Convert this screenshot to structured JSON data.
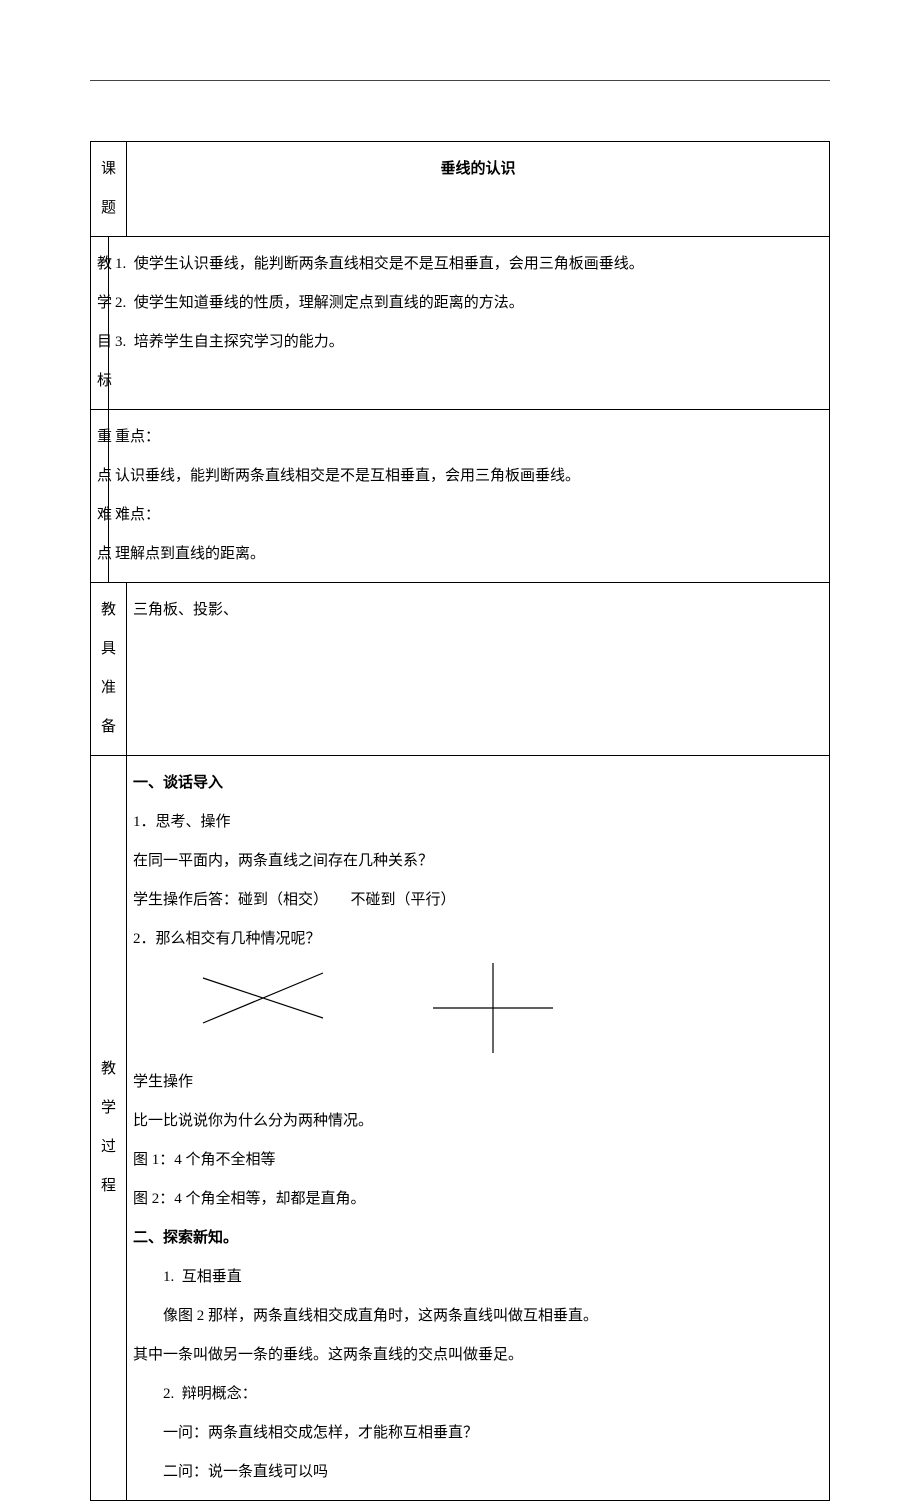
{
  "header": {
    "col_title_label": "课题",
    "title": "垂线的认识"
  },
  "objectives": {
    "label_chars": [
      "教",
      "学",
      "目",
      "标"
    ],
    "items": [
      {
        "num": "1.",
        "text": "使学生认识垂线，能判断两条直线相交是不是互相垂直，会用三角板画垂线。"
      },
      {
        "num": "2.",
        "text": "使学生知道垂线的性质，理解测定点到直线的距离的方法。"
      },
      {
        "num": "3.",
        "text": "培养学生自主探究学习的能力。"
      }
    ]
  },
  "key_difficulty": {
    "label_chars": [
      "重",
      "点",
      "难",
      "点"
    ],
    "key_label": "重点：",
    "key_text": "认识垂线，能判断两条直线相交是不是互相垂直，会用三角板画垂线。",
    "diff_label": "难点：",
    "diff_text": "理解点到直线的距离。"
  },
  "tools": {
    "label": "教具准备",
    "text": "三角板、投影、"
  },
  "process": {
    "label_chars": [
      "教",
      "学",
      "过",
      "程"
    ],
    "section1_heading": "一、谈话导入",
    "s1_l1": "1．思考、操作",
    "s1_l2": "在同一平面内，两条直线之间存在几种关系？",
    "s1_l3": "学生操作后答：碰到（相交）　　不碰到（平行）",
    "s1_l4": "2．那么相交有几种情况呢？",
    "s1_l5": "学生操作",
    "s1_l6": "比一比说说你为什么分为两种情况。",
    "s1_l7": "图 1：4 个角不全相等",
    "s1_l8": "图 2：4 个角全相等，却都是直角。",
    "section2_heading": "二、探索新知。",
    "s2_item1_num": "1.",
    "s2_item1_title": "互相垂直",
    "s2_item1_body1": "像图 2 那样，两条直线相交成直角时，这两条直线叫做互相垂直。",
    "s2_item1_body2": "其中一条叫做另一条的垂线。这两条直线的交点叫做垂足。",
    "s2_item2_num": "2.",
    "s2_item2_title": "辩明概念：",
    "s2_q1": "一问：两条直线相交成怎样，才能称互相垂直？",
    "s2_q2": "二问：说一条直线可以吗"
  }
}
